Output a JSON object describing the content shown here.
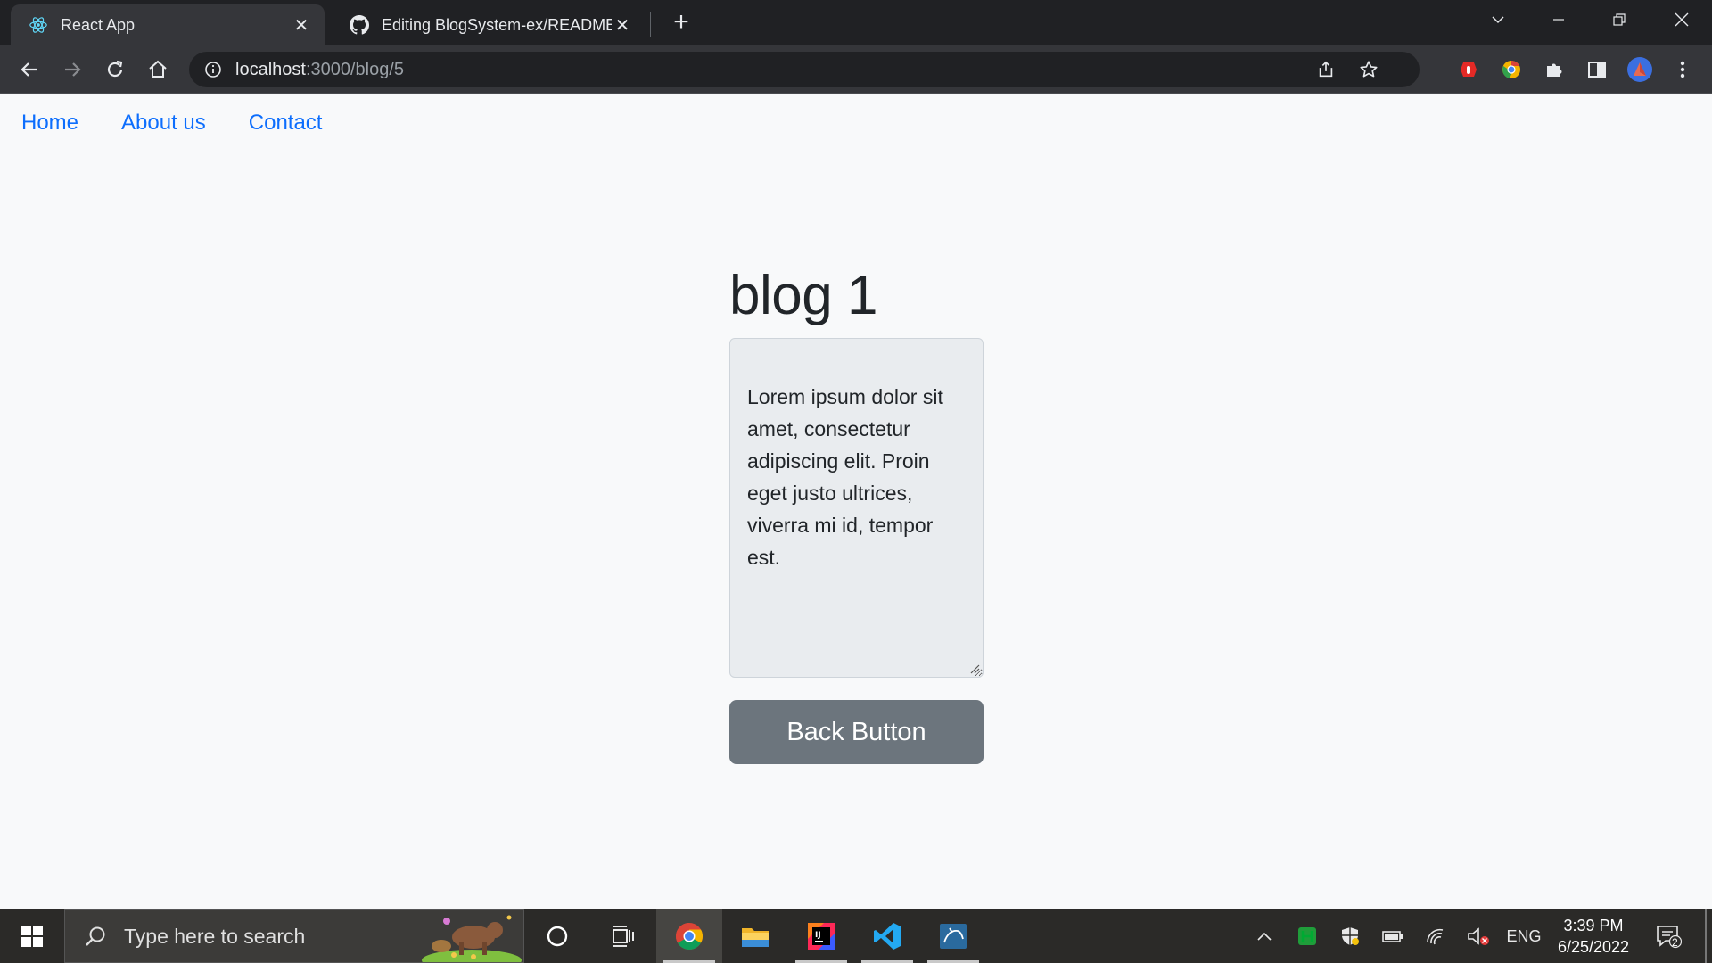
{
  "browser": {
    "tabs": [
      {
        "title": "React App",
        "icon": "react-icon",
        "active": true
      },
      {
        "title": "Editing BlogSystem-ex/README.md",
        "icon": "github-icon",
        "active": false
      }
    ],
    "address": {
      "host": "localhost",
      "path": ":3000/blog/5"
    }
  },
  "nav": {
    "links": [
      "Home",
      "About us",
      "Contact"
    ],
    "link_color": "#0d6efd"
  },
  "blog": {
    "title": "blog 1",
    "body": "Lorem ipsum dolor sit amet, consectetur adipiscing elit. Proin eget justo ultrices, viverra mi id, tempor est.",
    "back_label": "Back Button"
  },
  "taskbar": {
    "search_placeholder": "Type here to search",
    "language": "ENG",
    "time": "3:39 PM",
    "date": "6/25/2022",
    "notification_count": "2"
  }
}
